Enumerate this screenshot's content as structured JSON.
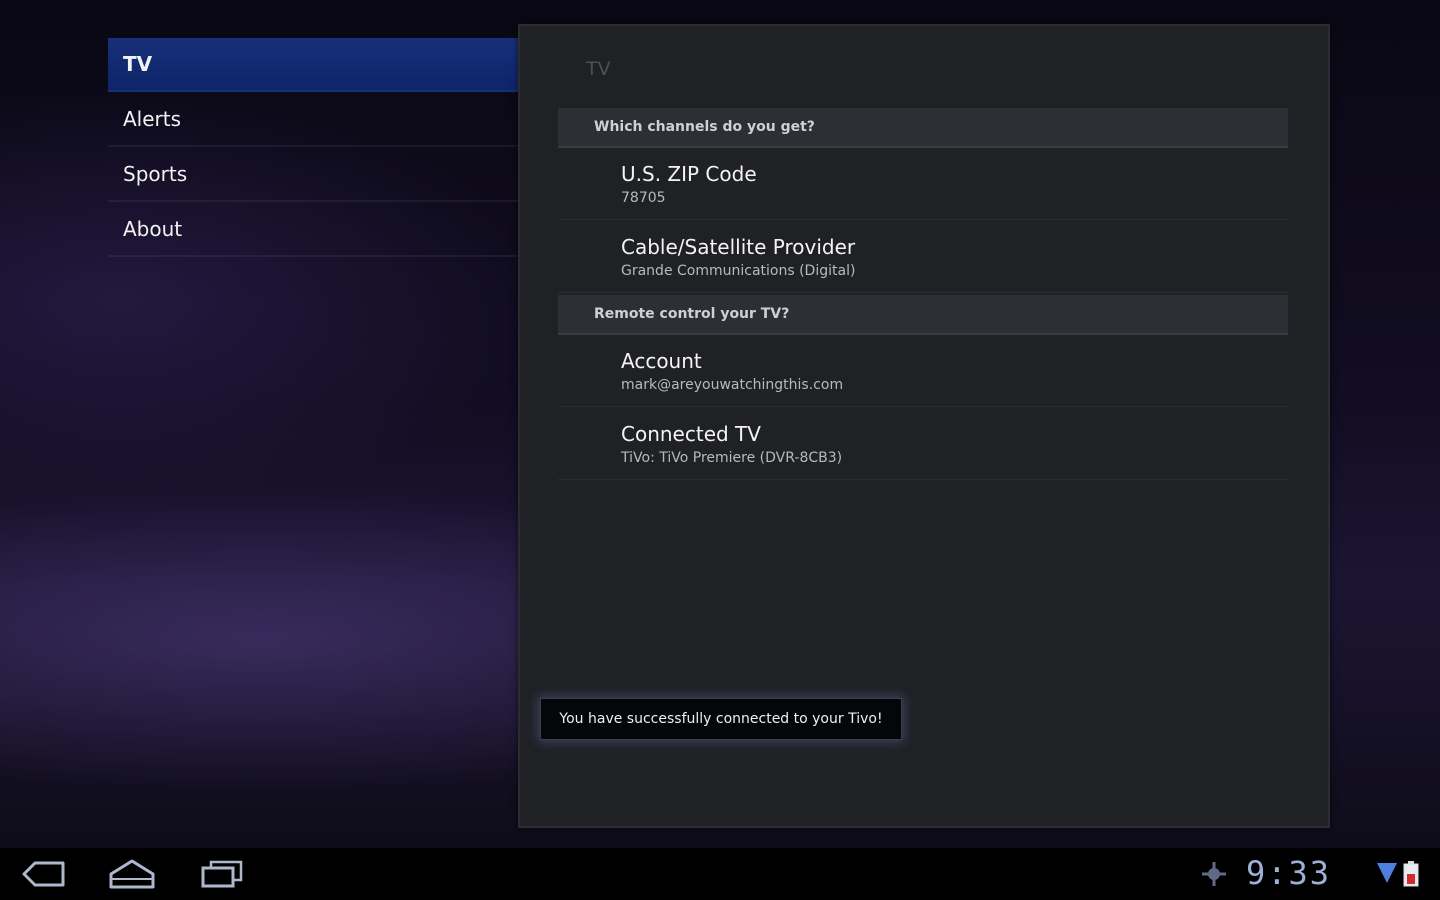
{
  "headers": [
    {
      "label": "TV",
      "selected": true
    },
    {
      "label": "Alerts",
      "selected": false
    },
    {
      "label": "Sports",
      "selected": false
    },
    {
      "label": "About",
      "selected": false
    }
  ],
  "panel": {
    "title": "TV",
    "categories": [
      {
        "label": "Which channels do you get?",
        "items": [
          {
            "title": "U.S. ZIP Code",
            "summary": "78705"
          },
          {
            "title": "Cable/Satellite Provider",
            "summary": "Grande Communications (Digital)"
          }
        ]
      },
      {
        "label": "Remote control your TV?",
        "items": [
          {
            "title": "Account",
            "summary": "mark@areyouwatchingthis.com"
          },
          {
            "title": "Connected TV",
            "summary": "TiVo: TiVo Premiere (DVR-8CB3)"
          }
        ]
      }
    ]
  },
  "toast": {
    "message": "You have successfully connected to your Tivo!"
  },
  "system_bar": {
    "clock": "9:33",
    "icons": [
      "back-icon",
      "home-icon",
      "recent-apps-icon",
      "usb-debug-icon",
      "wifi-icon",
      "battery-icon"
    ]
  },
  "colors": {
    "accent": "#16307a",
    "panel_bg": "#202125",
    "clock": "#9fb0d6"
  }
}
